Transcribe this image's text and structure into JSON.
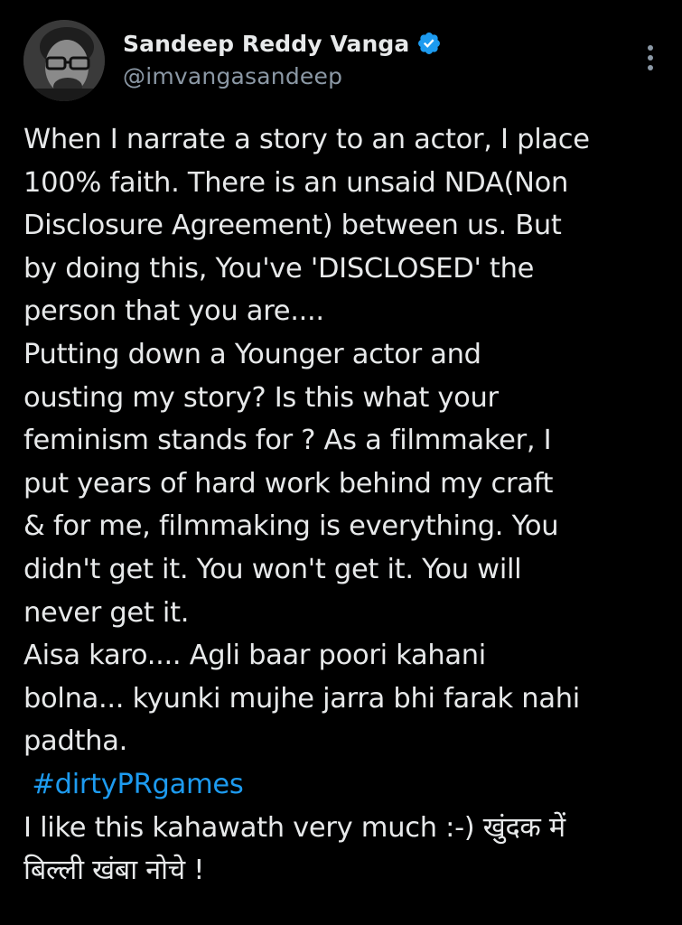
{
  "author": {
    "display_name": "Sandeep Reddy Vanga",
    "handle": "@imvangasandeep",
    "verified": true
  },
  "icons": {
    "verified": "verified-badge-icon",
    "more": "more-vertical-icon"
  },
  "colors": {
    "background": "#000000",
    "text": "#e7e9ea",
    "secondary_text": "#8b98a5",
    "accent": "#1d9bf0"
  },
  "tweet": {
    "lines": [
      "When I narrate a story to an actor, I place",
      "100% faith. There is an unsaid NDA(Non",
      "Disclosure Agreement) between us. But",
      "by doing this, You've 'DISCLOSED' the",
      "person that you are....",
      "Putting down a Younger actor and",
      "ousting my story?  Is this what your",
      "feminism stands for ? As a filmmaker, I",
      "put years of hard work behind my craft",
      "& for me, filmmaking is everything. You",
      "didn't get it. You won't get it. You will",
      "never get it.",
      "Aisa karo.... Agli baar poori kahani",
      "bolna... kyunki mujhe jarra bhi farak nahi",
      "padtha."
    ],
    "hashtag": "#dirtyPRgames",
    "closing_lines": [
      "I like this kahawath very much :-) खुंदक में",
      "बिल्ली खंबा नोचे !"
    ]
  }
}
